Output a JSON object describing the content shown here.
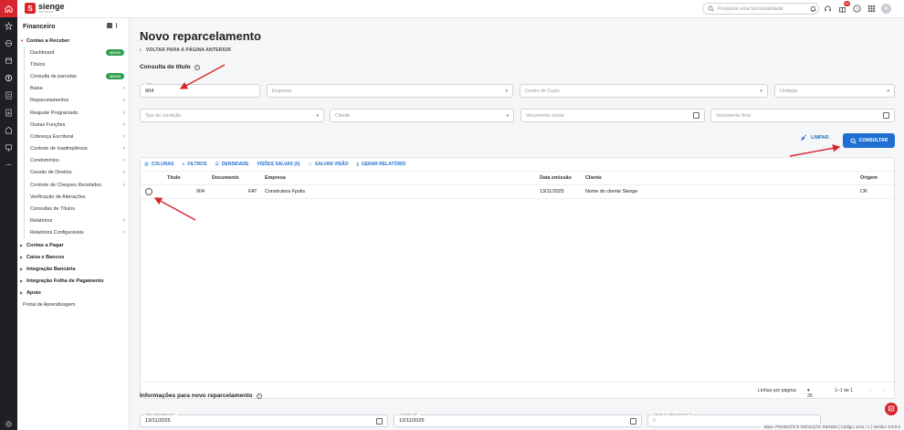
{
  "app": {
    "logo_text": "sienge",
    "logo_sub": "SOFTPLAN",
    "search_placeholder": "Pesquise uma funcionalidade",
    "notification_count": "33",
    "avatar_initial": "R"
  },
  "sidebar": {
    "title": "Financeiro",
    "section_receber": "Contas a Receber",
    "items": [
      {
        "label": "Dashboard",
        "badge": "NOVO",
        "chevron": false
      },
      {
        "label": "Títulos",
        "badge": "",
        "chevron": false
      },
      {
        "label": "Consulta de parcelas",
        "badge": "NOVO",
        "chevron": false
      },
      {
        "label": "Baixa",
        "badge": "",
        "chevron": true
      },
      {
        "label": "Reparcelamentos",
        "badge": "",
        "chevron": true
      },
      {
        "label": "Reajuste Programado",
        "badge": "",
        "chevron": true
      },
      {
        "label": "Outras Funções",
        "badge": "",
        "chevron": true
      },
      {
        "label": "Cobrança Escritural",
        "badge": "",
        "chevron": true
      },
      {
        "label": "Controle de Inadimplência",
        "badge": "",
        "chevron": true
      },
      {
        "label": "Condomínios",
        "badge": "",
        "chevron": true
      },
      {
        "label": "Cessão de Direitos",
        "badge": "",
        "chevron": true
      },
      {
        "label": "Controle de Cheques Recebidos",
        "badge": "",
        "chevron": true
      },
      {
        "label": "Verificação de Alterações",
        "badge": "",
        "chevron": false
      },
      {
        "label": "Consultas de Títulos",
        "badge": "",
        "chevron": false
      },
      {
        "label": "Relatórios",
        "badge": "",
        "chevron": true
      },
      {
        "label": "Relatórios Configuráveis",
        "badge": "",
        "chevron": true
      }
    ],
    "sections": [
      "Contas a Pagar",
      "Caixa e Bancos",
      "Integração Bancária",
      "Integração Folha de Pagamento",
      "Apoio"
    ],
    "portal": "Portal de Aprendizagem"
  },
  "page": {
    "title": "Novo reparcelamento",
    "back_label": "VOLTAR PARA A PÁGINA ANTERIOR",
    "consulta_title": "Consulta de título",
    "info_title": "Informações para novo reparcelamento"
  },
  "filters": {
    "titulo_label": "Título",
    "titulo_value": "904",
    "empresa": "Empresa",
    "centro_custo": "Centro de Custo",
    "unidade": "Unidade",
    "tipo_condicao": "Tipo de condição",
    "cliente": "Cliente",
    "venc_inicial": "Vencimento inicial",
    "venc_final": "Vencimento final"
  },
  "actions": {
    "limpar": "LIMPAR",
    "consultar": "CONSULTAR"
  },
  "toolbar": {
    "colunas": "COLUNAS",
    "filtros": "FILTROS",
    "densidade": "DENSIDADE",
    "visoes": "VISÕES SALVAS (0)",
    "salvar": "SALVAR VISÃO",
    "gerar": "GERAR RELATÓRIO"
  },
  "table": {
    "headers": {
      "titulo": "Título",
      "documento": "Documento",
      "empresa": "Empresa",
      "data": "Data emissão",
      "cliente": "Cliente",
      "origem": "Origem"
    },
    "rows": [
      {
        "titulo": "904",
        "documento": "FAT",
        "empresa": "Construtora Fpolis",
        "data": "13/11/2025",
        "cliente": "Nome do cliente Sienge",
        "origem": "CR"
      }
    ],
    "footer": {
      "rows_label": "Linhas por página:",
      "rows_value": "25",
      "range": "1–1 de 1"
    }
  },
  "reparcel": {
    "data_label": "Data reparcelamento *",
    "data_value": "13/11/2025",
    "correcao_label": "Correção até *",
    "correcao_value": "13/11/2025",
    "calculo_label": "Cálculo do valor presente %",
    "calculo_value": "0"
  },
  "status_text": "Base: PRODUTO E INOVAÇÃO SIENGE | Código: 4211 / 1 | Versão: 9.0.9-2",
  "colors": {
    "brand": "#d7272e",
    "accent": "#1f6fd1",
    "new_badge": "#2e9e4b"
  }
}
